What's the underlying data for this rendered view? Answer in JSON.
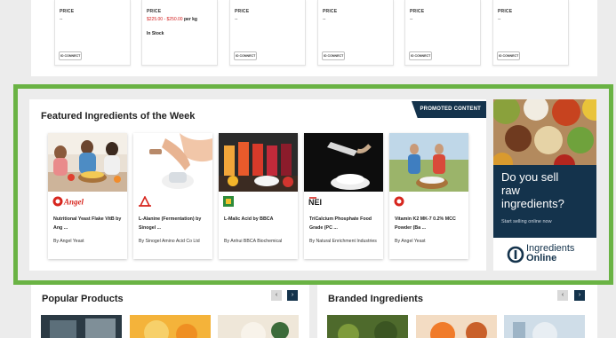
{
  "price_cards": [
    {
      "price_label": "PRICE",
      "price_value": "--",
      "in_stock": "",
      "button_label": "IO CONNECT"
    },
    {
      "price_label": "PRICE",
      "price_value": "$225.00 - $250.00",
      "price_unit": " per kg",
      "in_stock": "In Stock",
      "button_label": ""
    },
    {
      "price_label": "PRICE",
      "price_value": "--",
      "in_stock": "",
      "button_label": "IO CONNECT"
    },
    {
      "price_label": "PRICE",
      "price_value": "--",
      "in_stock": "",
      "button_label": "IO CONNECT"
    },
    {
      "price_label": "PRICE",
      "price_value": "--",
      "in_stock": "",
      "button_label": "IO CONNECT"
    },
    {
      "price_label": "PRICE",
      "price_value": "--",
      "in_stock": "",
      "button_label": "IO CONNECT"
    }
  ],
  "featured": {
    "title": "Featured Ingredients of the Week",
    "promoted_label": "PROMOTED CONTENT",
    "items": [
      {
        "name": "Nutritional Yeast Flake VitB by Ang ...",
        "by": "By Angel Yeast",
        "logo": "angel-logo",
        "logo_text": "Angel"
      },
      {
        "name": "L-Alanine (Fermentation) by Sinogel ...",
        "by": "By Sinogel Amino Acid Co Ltd",
        "logo": "sinogel-logo",
        "logo_text": ""
      },
      {
        "name": "L-Malic Acid by BBCA",
        "by": "By Anhui BBCA Biochemical",
        "logo": "bbca-logo",
        "logo_text": ""
      },
      {
        "name": "TriCalcium Phosphate Food Grade (PC ...",
        "by": "By Natural Enrichment Industries",
        "logo": "nei-logo",
        "logo_text": "NEI"
      },
      {
        "name": "Vitamin K2 MK-7 0.2% MCC Powder (Ba ...",
        "by": "By Angel Yeast",
        "logo": "angel-logo",
        "logo_text": ""
      }
    ]
  },
  "ad": {
    "headline": [
      "Do you sell",
      "raw",
      "ingredients?"
    ],
    "subline": "Start selling online now",
    "brand_line1": "Ingredients",
    "brand_line2": "Online"
  },
  "sections": {
    "popular_title": "Popular Products",
    "branded_title": "Branded Ingredients",
    "prev_icon": "chevron-left-icon",
    "next_icon": "chevron-right-icon"
  },
  "colors": {
    "accent_green": "#6ab344",
    "navy": "#14334c",
    "price_red": "#d32020"
  }
}
